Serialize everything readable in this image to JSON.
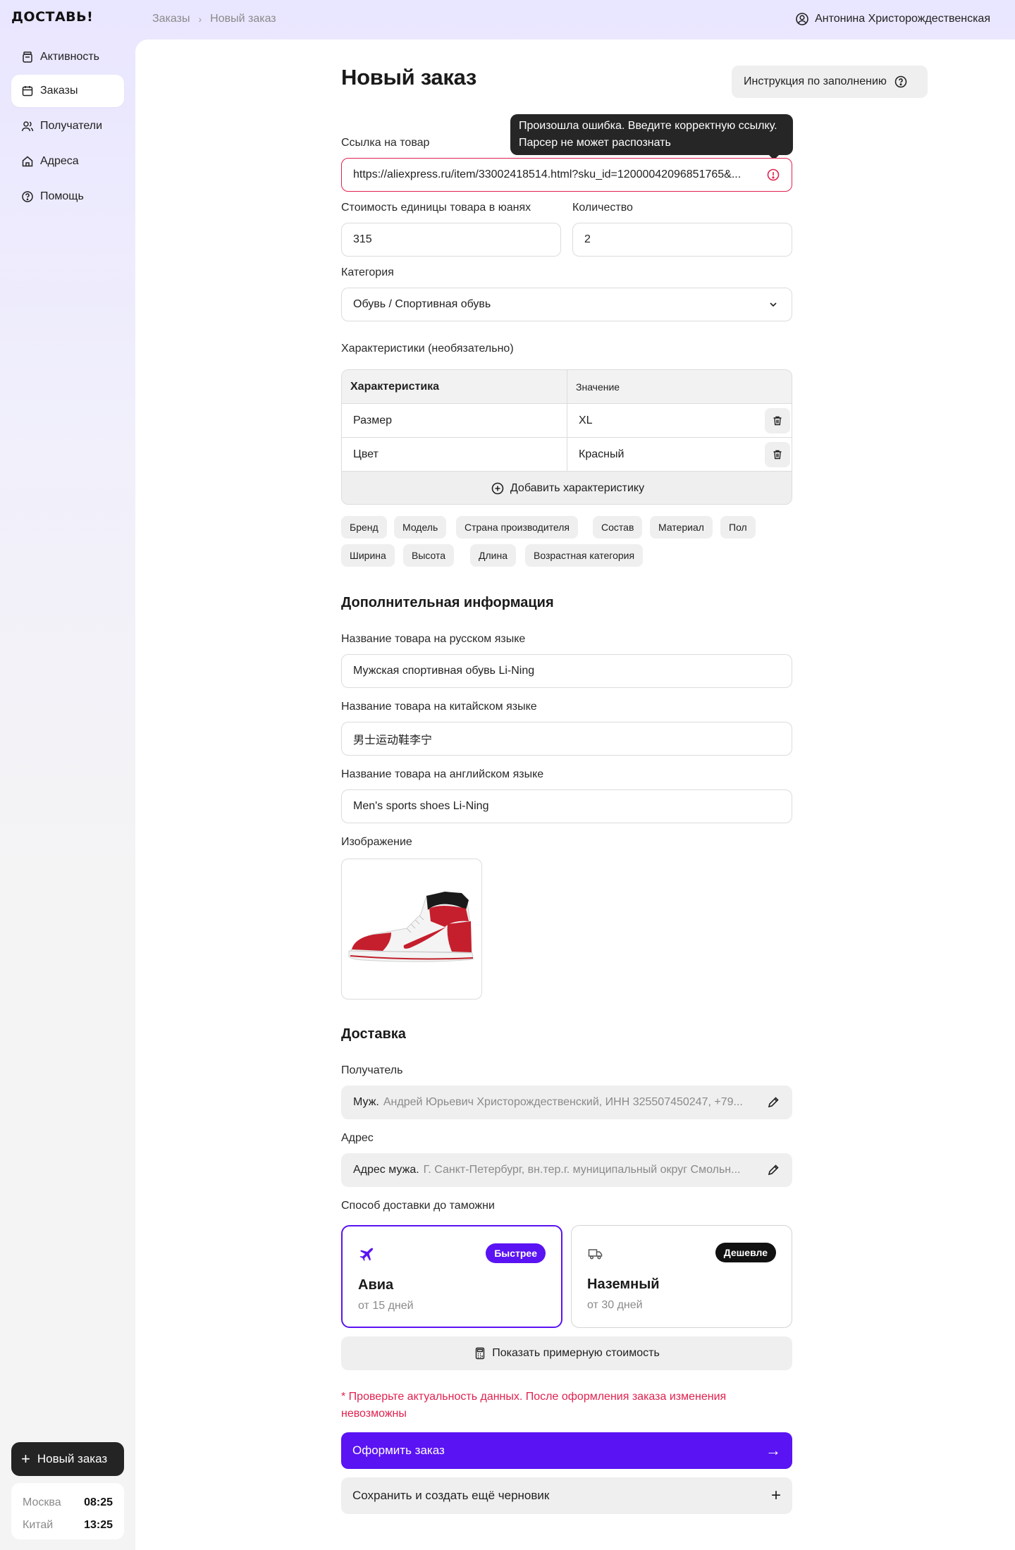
{
  "app": {
    "logo": "ДОСТАВЬ!"
  },
  "breadcrumb": {
    "items": [
      "Заказы",
      "Новый заказ"
    ],
    "separator": "›"
  },
  "user": {
    "name": "Антонина Христорождественская",
    "icon": "user-circle-icon"
  },
  "sidebar": {
    "items": [
      {
        "label": "Активность",
        "icon": "jar-icon",
        "active": false
      },
      {
        "label": "Заказы",
        "icon": "calendar-icon",
        "active": true
      },
      {
        "label": "Получатели",
        "icon": "users-icon",
        "active": false
      },
      {
        "label": "Адреса",
        "icon": "home-icon",
        "active": false
      },
      {
        "label": "Помощь",
        "icon": "question-circle-icon",
        "active": false
      }
    ],
    "new_order_label": "Новый заказ",
    "clocks": [
      {
        "city": "Москва",
        "time": "08:25"
      },
      {
        "city": "Китай",
        "time": "13:25"
      }
    ]
  },
  "page": {
    "title": "Новый заказ",
    "help_button": "Инструкция по заполнению"
  },
  "form": {
    "url": {
      "label": "Ссылка на товар",
      "value": "https://aliexpress.ru/item/33002418514.html?sku_id=12000042096851765&...",
      "error_tooltip": "Произошла ошибка. Введите корректную ссылку. Парсер не может распознать"
    },
    "price": {
      "label": "Стоимость единицы товара в юанях",
      "value": "315"
    },
    "quantity": {
      "label": "Количество",
      "value": "2"
    },
    "category": {
      "label": "Категория",
      "value": "Обувь / Спортивная обувь"
    },
    "characteristics": {
      "label": "Характеристики (необязательно)",
      "col_name": "Характеристика",
      "col_value": "Значение",
      "rows": [
        {
          "name": "Размер",
          "value": "XL"
        },
        {
          "name": "Цвет",
          "value": "Красный"
        }
      ],
      "add_label": "Добавить характеристику",
      "suggestions": [
        "Бренд",
        "Модель",
        "Страна производителя",
        "Состав",
        "Материал",
        "Пол",
        "Ширина",
        "Высота",
        "Длина",
        "Возрастная категория"
      ]
    }
  },
  "extra": {
    "heading": "Дополнительная информация",
    "name_ru": {
      "label": "Название товара на русском языке",
      "value": "Мужская спортивная обувь Li-Ning"
    },
    "name_cn": {
      "label": "Название товара на китайском языке",
      "value": "男士运动鞋李宁"
    },
    "name_en": {
      "label": "Название товара на английском языке",
      "value": "Men's sports shoes Li-Ning"
    },
    "image_label": "Изображение"
  },
  "delivery": {
    "heading": "Доставка",
    "recipient": {
      "label": "Получатель",
      "prefix": "Муж.",
      "value": "Андрей Юрьевич Христорождественский, ИНН 325507450247, +79..."
    },
    "address": {
      "label": "Адрес",
      "prefix": "Адрес мужа.",
      "value": "Г. Санкт-Петербург, вн.тер.г. муниципальный округ Смольн..."
    },
    "method_label": "Способ доставки до таможни",
    "methods": [
      {
        "title": "Авиа",
        "sub": "от 15 дней",
        "badge": "Быстрее",
        "icon": "plane-icon",
        "selected": true
      },
      {
        "title": "Наземный",
        "sub": "от 30 дней",
        "badge": "Дешевле",
        "icon": "truck-icon",
        "selected": false
      }
    ],
    "estimate_button": "Показать примерную стоимость",
    "warning": "* Проверьте актуальность данных. После оформления заказа изменения невозможны",
    "submit": "Оформить заказ",
    "draft": "Сохранить и создать ещё черновик"
  },
  "colors": {
    "accent": "#5a13f2",
    "error": "#e0224f",
    "dark": "#242424"
  }
}
